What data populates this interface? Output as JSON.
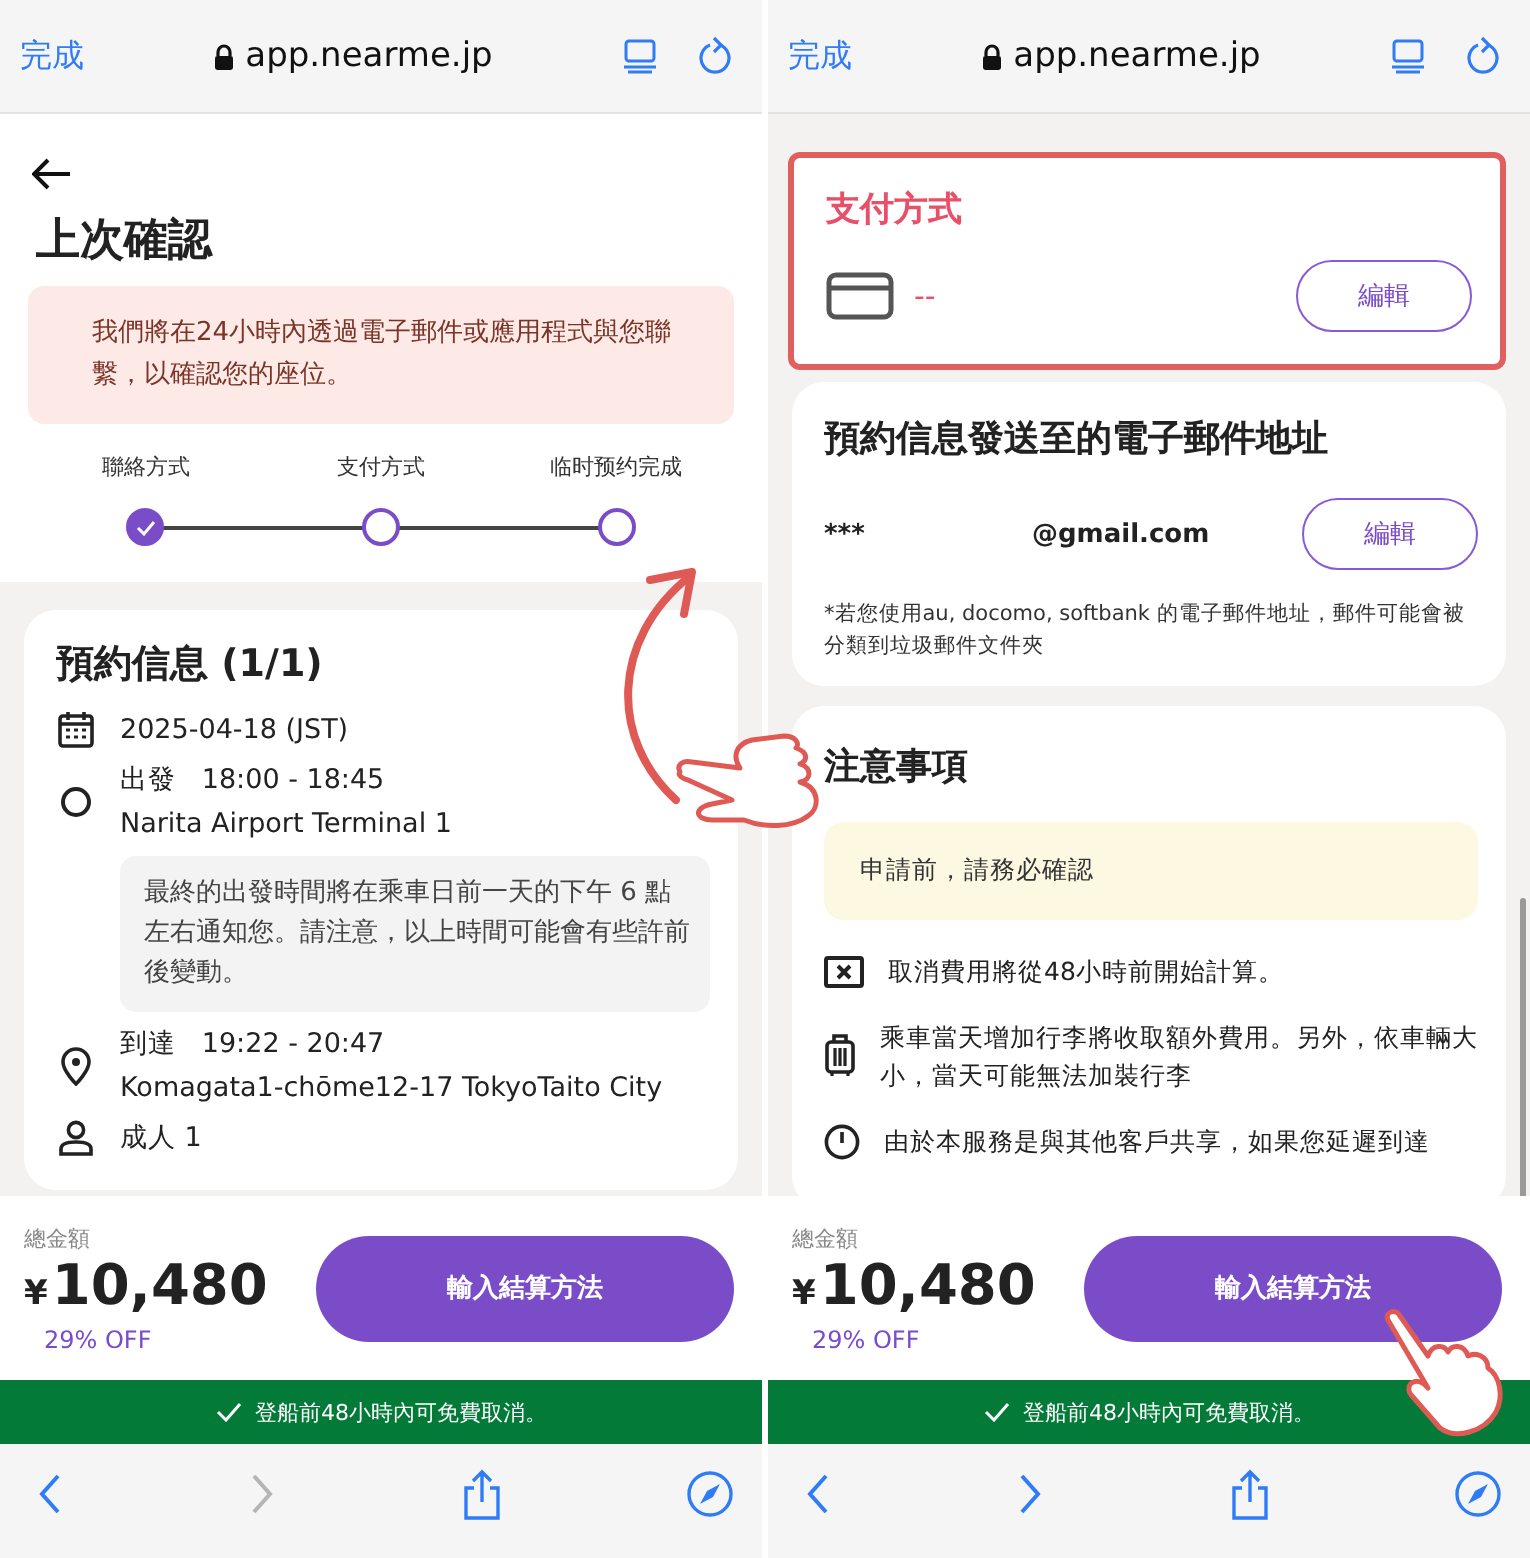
{
  "left_screen": {
    "browser": {
      "done": "完成",
      "url": "app.nearme.jp"
    },
    "page_title": "上次確認",
    "notice": "我們將在24小時內透過電子郵件或應用程式與您聯繫，以確認您的座位。",
    "steps": [
      {
        "label": "聯絡方式",
        "completed": true
      },
      {
        "label": "支付方式",
        "completed": false
      },
      {
        "label": "临时预约完成",
        "completed": false
      }
    ],
    "booking_card": {
      "title": "預約信息 (1/1)",
      "date": "2025-04-18 (JST)",
      "departure": {
        "label": "出發",
        "time": "18:00 - 18:45",
        "place": "Narita Airport Terminal 1"
      },
      "note": "最終的出發時間將在乘車日前一天的下午 6 點左右通知您。請注意，以上時間可能會有些許前後變動。",
      "arrival": {
        "label": "到達",
        "time": "19:22 - 20:47",
        "place": "Komagata1-chōme12-17 TokyoTaito City"
      },
      "passengers": "成人 1"
    },
    "footer": {
      "total_label": "總金額",
      "currency": "¥",
      "price": "10,480",
      "discount": "29% OFF",
      "button": "輸入結算方法"
    },
    "banner": "登船前48小時內可免費取消。",
    "toolbar": {
      "forward_disabled": true
    }
  },
  "right_screen": {
    "browser": {
      "done": "完成",
      "url": "app.nearme.jp"
    },
    "payment_card": {
      "title": "支付方式",
      "highlighted": true,
      "value": "--",
      "button": "編輯"
    },
    "email_card": {
      "title": "預約信息發送至的電子郵件地址",
      "user": "***",
      "domain": "@gmail.com",
      "button": "編輯",
      "note": "*若您使用au, docomo, softbank 的電子郵件地址，郵件可能會被分類到垃圾郵件文件夾"
    },
    "notes_card": {
      "title": "注意事項",
      "warning": "申請前，請務必確認",
      "items": [
        {
          "kind": "cancel",
          "text": "取消費用將從48小時前開始計算。"
        },
        {
          "kind": "luggage",
          "text": "乘車當天增加行李將收取額外費用。另外，依車輛大小，當天可能無法加裝行李"
        },
        {
          "kind": "time",
          "text": "由於本服務是與其他客戶共享，如果您延遲到達"
        }
      ]
    },
    "footer": {
      "total_label": "總金額",
      "currency": "¥",
      "price": "10,480",
      "discount": "29% OFF",
      "button": "輸入結算方法"
    },
    "banner": "登船前48小時內可免費取消。",
    "toolbar": {
      "forward_disabled": false
    }
  }
}
